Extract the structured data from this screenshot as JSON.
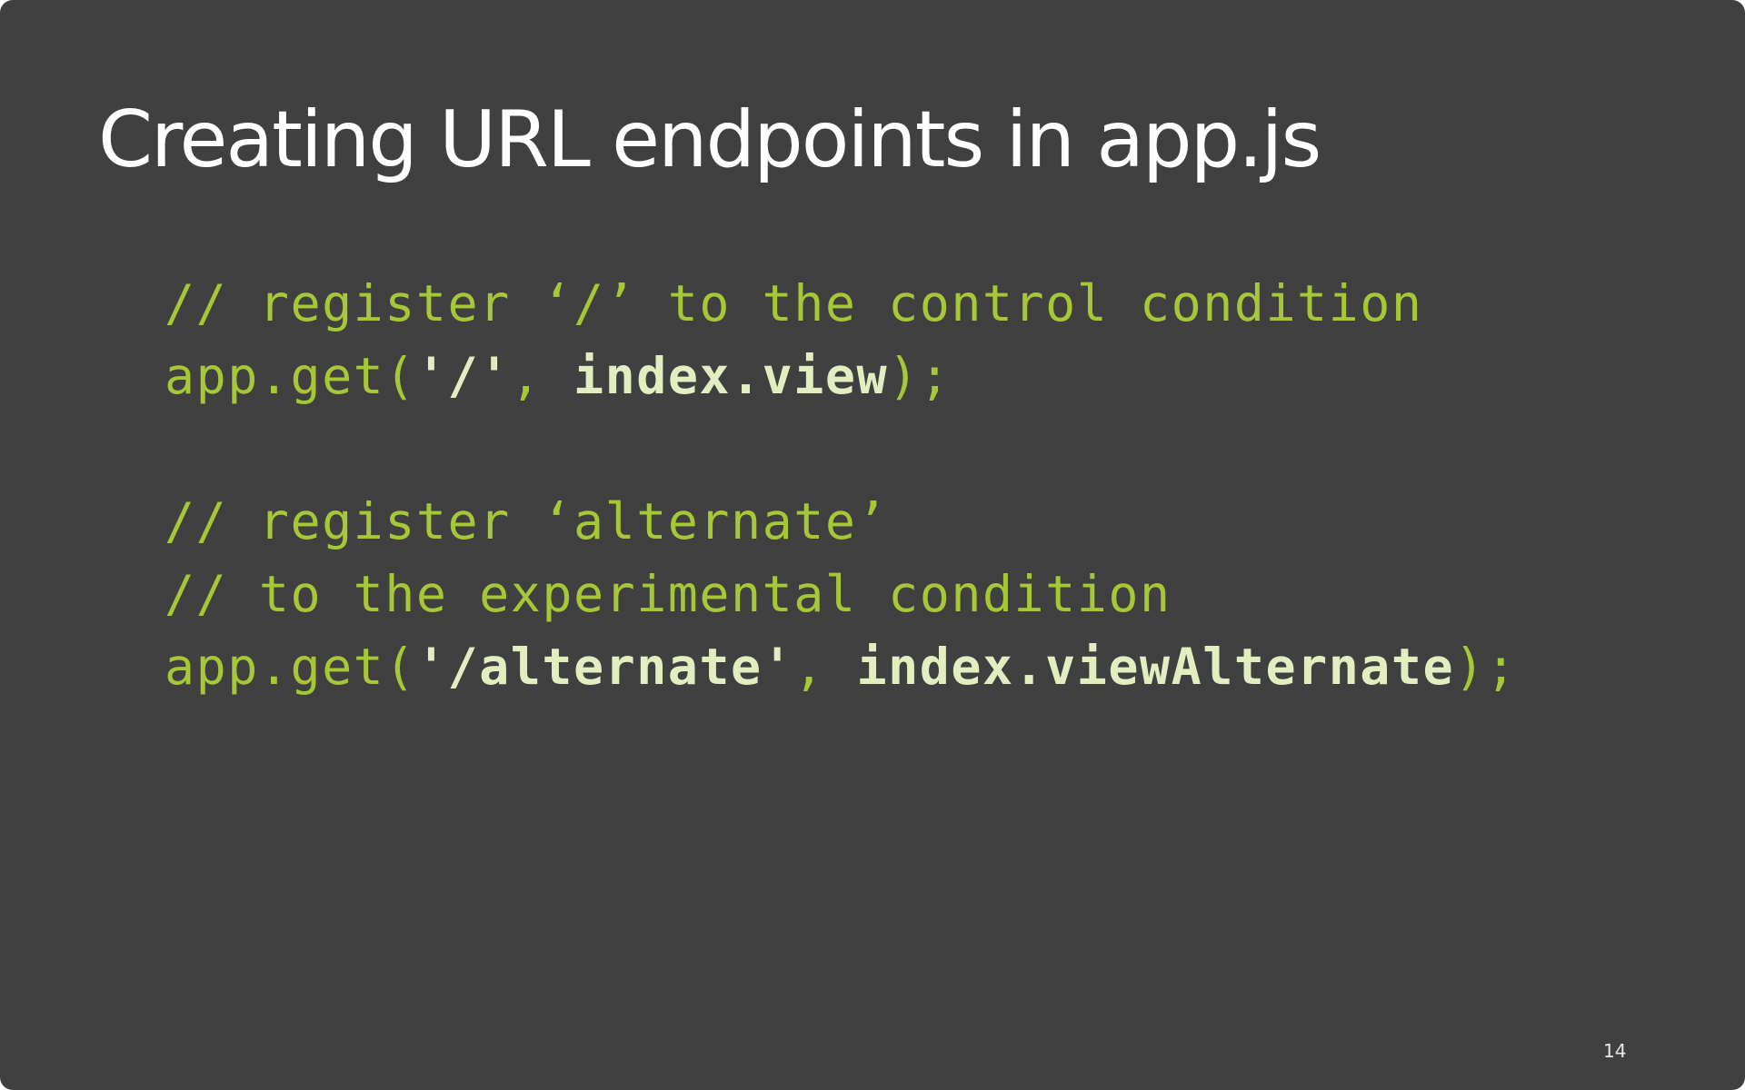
{
  "slide": {
    "title": "Creating URL endpoints in app.js",
    "page_number": "14",
    "colors": {
      "background": "#404040",
      "title": "#ffffff",
      "code_text": "#a6c736",
      "code_highlight": "#e2eec0"
    }
  },
  "code": {
    "line1": "// register ‘/’ to the control condition",
    "line2": {
      "prefix": "app.get(",
      "path": "'/'",
      "sep": ", ",
      "handler": "index.view",
      "suffix": ");"
    },
    "line3": "// register ‘alternate’",
    "line4": "// to the experimental condition",
    "line5": {
      "prefix": "app.get(",
      "path": "'/alternate'",
      "sep": ", ",
      "handler": "index.viewAlternate",
      "suffix": ");"
    }
  }
}
